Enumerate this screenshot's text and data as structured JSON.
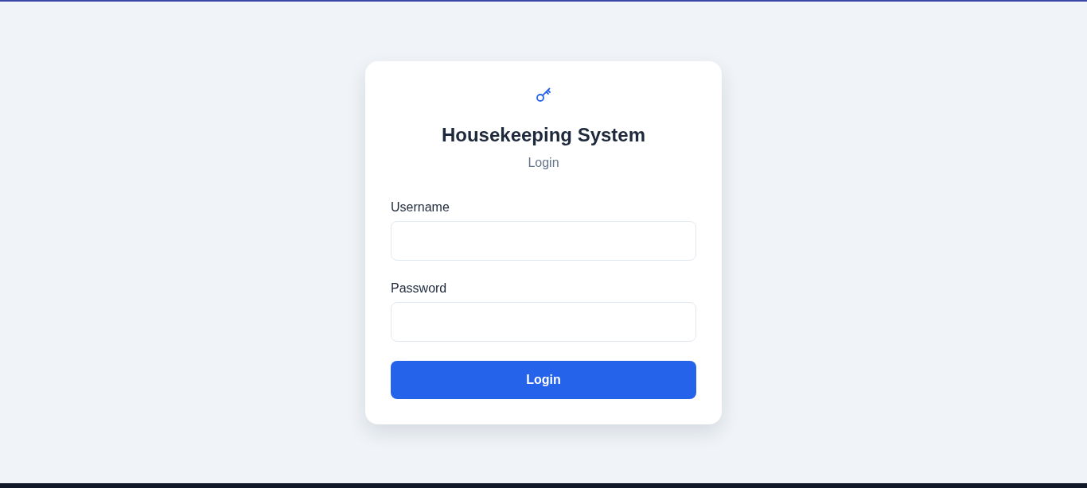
{
  "login_card": {
    "title": "Housekeeping System",
    "subtitle": "Login",
    "fields": [
      {
        "label": "Username"
      },
      {
        "label": "Password"
      }
    ],
    "submit_button": "Login"
  }
}
